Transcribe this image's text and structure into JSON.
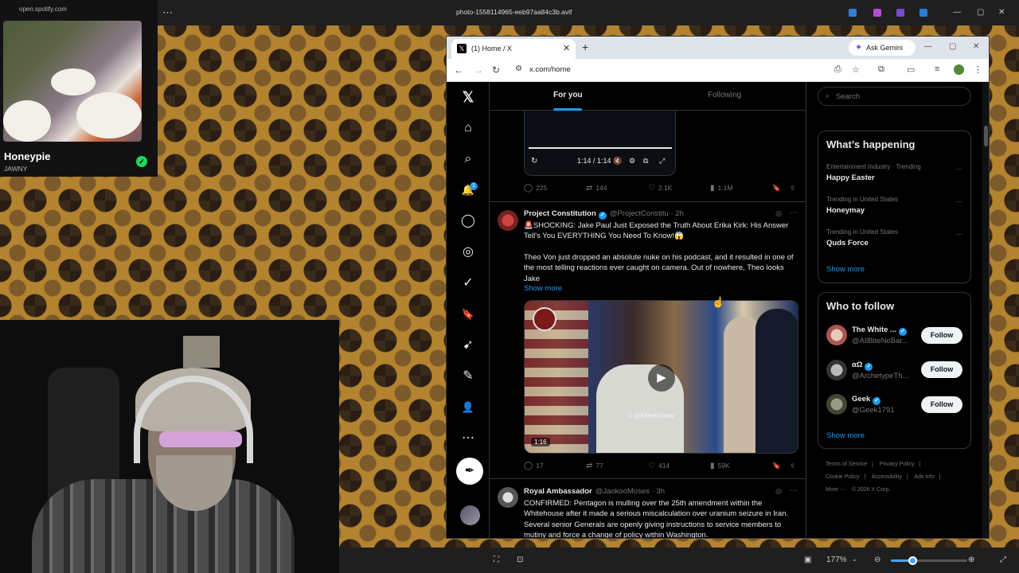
{
  "viewer": {
    "title": "photo-1558114965-eeb97aa84c3b.avif",
    "zoom": "177%",
    "zoom_level": 0.33
  },
  "spotify": {
    "url": "open.spotify.com",
    "track": "Honeypie",
    "artist": "JAWNY"
  },
  "browser": {
    "tab_title": "(1) Home / X",
    "url": "x.com/home",
    "gemini_label": "Ask Gemini"
  },
  "x": {
    "notifications_count": "1",
    "tabs": {
      "for_you": "For you",
      "following": "Following"
    },
    "prev_video": {
      "time": "1:14 / 1:14",
      "stats": {
        "replies": "225",
        "reposts": "144",
        "likes": "2.1K",
        "views": "1.1M"
      }
    },
    "tweet1": {
      "name": "Project Constitution",
      "handle": "@ProjectConstitu · 2h",
      "headline": "🚨SHOCKING: Jake Paul Just Exposed the Truth About Erika Kirk: His Answer Tell's You EVERYTHING You Need To Know!😱",
      "body": "Theo Von just dropped an absolute nuke on his podcast, and it resulted in one of the most telling reactions ever caught on camera. Out of nowhere, Theo looks Jake",
      "show_more": "Show more",
      "media_duration": "1:16",
      "media_watermark": "X @KillerKreww",
      "stats": {
        "replies": "17",
        "reposts": "77",
        "likes": "414",
        "views": "59K"
      }
    },
    "tweet2": {
      "name": "Royal Ambassador",
      "handle": "@JaokooMoses · 3h",
      "body": "CONFIRMED: Pentagon is mulling over the 25th amendment  within the Whitehouse after it made a serious miscalculation over uranium seizure in Iran. Several senior Generals are openly giving instructions to service members to mutiny and force a change of policy within Washington."
    },
    "search_placeholder": "Search",
    "whats_happening": {
      "title": "What’s happening",
      "trends": [
        {
          "category": "Entertainment Industry · Trending",
          "name": "Happy Easter"
        },
        {
          "category": "Trending in United States",
          "name": "Honeymay"
        },
        {
          "category": "Trending in United States",
          "name": "Quds Force"
        }
      ],
      "show_more": "Show more"
    },
    "who_to_follow": {
      "title": "Who to follow",
      "accounts": [
        {
          "name": "The White ...",
          "handle": "@AllBiteNoBar...",
          "button": "Follow"
        },
        {
          "name": "αΩ",
          "handle": "@ArchetypeTh...",
          "button": "Follow"
        },
        {
          "name": "Geek",
          "handle": "@Geek1791",
          "button": "Follow"
        }
      ],
      "show_more": "Show more"
    },
    "footer": [
      "Terms of Service",
      "|",
      "Privacy Policy",
      "|",
      "Cookie Policy",
      "|",
      "Accessibility",
      "|",
      "Ads info",
      "|",
      "More ···",
      "© 2026 X Corp."
    ]
  },
  "icons": {
    "x_logo": "𝕏",
    "home": "⌂",
    "search": "⌕",
    "bell": "🔔",
    "messages": "◯",
    "grok": "◎",
    "verified": "✓",
    "bookmarks": "🔖",
    "rocket": "➹",
    "compose_list": "✎",
    "profile": "👤",
    "more": "⋯",
    "post": "✒",
    "reply": "◯",
    "repost": "⇄",
    "like": "♡",
    "views": "▮",
    "bookmark": "🔖",
    "share": "⇪"
  },
  "colors": {
    "accent": "#1d9bf0",
    "spotify_green": "#1ed760"
  }
}
